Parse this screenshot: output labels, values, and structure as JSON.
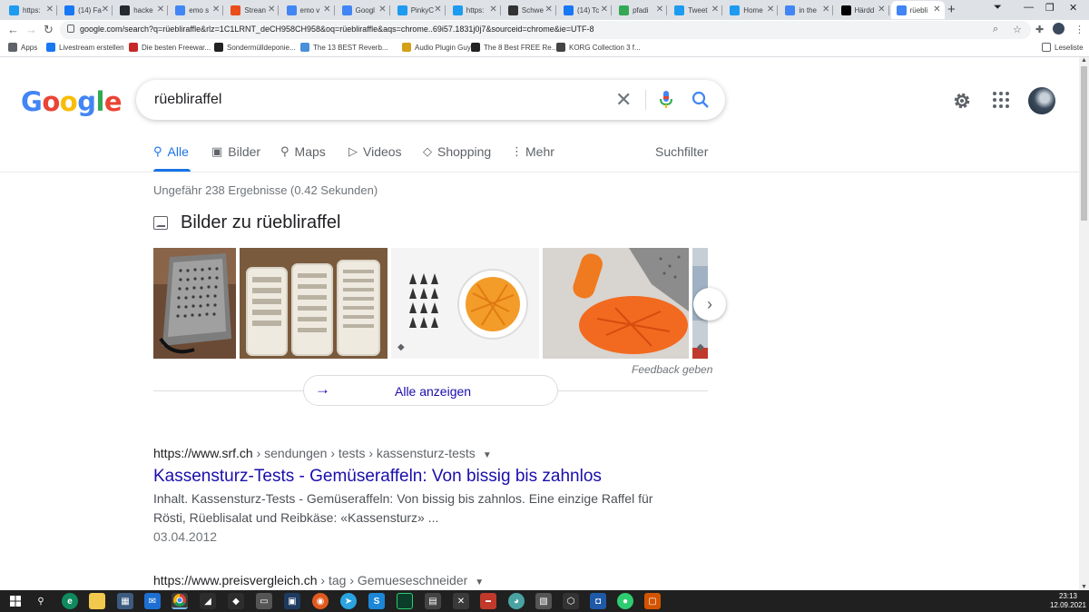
{
  "browser": {
    "tabs": [
      {
        "label": "https:",
        "icon": "twitter-icon",
        "color": "#1d9bf0"
      },
      {
        "label": "(14) Fa",
        "icon": "facebook-icon",
        "color": "#1877f2"
      },
      {
        "label": "hacke",
        "icon": "github-icon",
        "color": "#24292f"
      },
      {
        "label": "emo s",
        "icon": "google-icon",
        "color": "#4285f4"
      },
      {
        "label": "Strean",
        "icon": "stream-icon",
        "color": "#e94e1b"
      },
      {
        "label": "emo v",
        "icon": "google-icon",
        "color": "#4285f4"
      },
      {
        "label": "Googl",
        "icon": "google-translate-icon",
        "color": "#4285f4"
      },
      {
        "label": "PinkyC",
        "icon": "twitter-icon",
        "color": "#1d9bf0"
      },
      {
        "label": "https:",
        "icon": "twitter-icon",
        "color": "#1d9bf0"
      },
      {
        "label": "Schwe",
        "icon": "news-icon",
        "color": "#333333"
      },
      {
        "label": "(14) Tc",
        "icon": "facebook-icon",
        "color": "#1877f2"
      },
      {
        "label": "pfadi",
        "icon": "maps-icon",
        "color": "#34a853"
      },
      {
        "label": "Tweet",
        "icon": "tweetdeck-icon",
        "color": "#1d9bf0"
      },
      {
        "label": "Home",
        "icon": "twitter-icon",
        "color": "#1d9bf0"
      },
      {
        "label": "in the",
        "icon": "google-icon",
        "color": "#4285f4"
      },
      {
        "label": "Härdd",
        "icon": "wikipedia-icon",
        "color": "#000000"
      },
      {
        "label": "rüebli",
        "icon": "google-icon",
        "color": "#4285f4",
        "active": true
      }
    ],
    "url": "google.com/search?q=rüebliraffle&rlz=1C1LRNT_deCH958CH958&oq=rüebliraffle&aqs=chrome..69i57.1831j0j7&sourceid=chrome&ie=UTF-8",
    "bookmarks": [
      {
        "label": "Apps",
        "icon": "apps-icon",
        "color": "#5f6368"
      },
      {
        "label": "Livestream erstellen",
        "icon": "facebook-icon",
        "color": "#1877f2"
      },
      {
        "label": "Die besten Freewar...",
        "icon": "star-icon",
        "color": "#c62828"
      },
      {
        "label": "Sondermülldeponie...",
        "icon": "wordpress-icon",
        "color": "#222222"
      },
      {
        "label": "The 13 BEST Reverb...",
        "icon": "audio-icon",
        "color": "#4a90d9"
      },
      {
        "label": "Audio Plugin Guy |...",
        "icon": "plugin-icon",
        "color": "#d4a017"
      },
      {
        "label": "The 8 Best FREE Re...",
        "icon": "moon-icon",
        "color": "#222222"
      },
      {
        "label": "KORG Collection 3 f...",
        "icon": "korg-icon",
        "color": "#444444"
      }
    ],
    "reading_list": "Leseliste"
  },
  "google": {
    "logo": "Google",
    "query": "rüebliraffel",
    "nav": {
      "all": "Alle",
      "images": "Bilder",
      "maps": "Maps",
      "videos": "Videos",
      "shopping": "Shopping",
      "more": "Mehr",
      "filter": "Suchfilter"
    },
    "result_stats": "Ungefähr 238 Ergebnisse (0.42 Sekunden)",
    "images": {
      "heading": "Bilder zu rüebliraffel",
      "feedback": "Feedback geben",
      "view_all": "Alle anzeigen"
    },
    "results": [
      {
        "site": "https://www.srf.ch",
        "breadcrumb": " › sendungen › tests › kassensturz-tests",
        "title": "Kassensturz-Tests - Gemüseraffeln: Von bissig bis zahnlos",
        "snippet": "Inhalt. Kassensturz-Tests - Gemüseraffeln: Von bissig bis zahnlos. Eine einzige Raffel für Rösti, Rüeblisalat und Reibkäse: «Kassensturz» ...",
        "date": "03.04.2012"
      },
      {
        "site": "https://www.preisvergleich.ch",
        "breadcrumb": " › tag › Gemueseschneider"
      }
    ]
  },
  "taskbar": {
    "time": "23:13",
    "date": "12.09.2021"
  }
}
